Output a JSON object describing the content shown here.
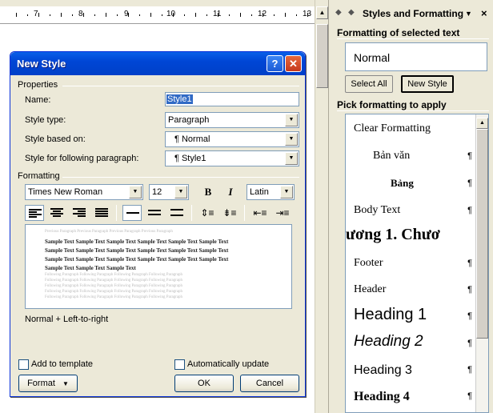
{
  "ruler": {
    "numbers": [
      "7",
      "8",
      "9",
      "10",
      "11",
      "12",
      "13"
    ]
  },
  "task_pane": {
    "title": "Styles and Formatting",
    "back_icon": "back-arrow-icon",
    "forward_icon": "forward-arrow-icon",
    "section1_title": "Formatting of selected text",
    "current_style": "Normal",
    "select_all_label": "Select All",
    "new_style_label": "New Style",
    "section2_title": "Pick formatting to apply",
    "styles": [
      {
        "label": "Clear Formatting",
        "pilcrow": ""
      },
      {
        "label": "Bản văn",
        "pilcrow": "¶"
      },
      {
        "label": "Bảng",
        "pilcrow": "¶"
      },
      {
        "label": "Body Text",
        "pilcrow": "¶"
      },
      {
        "label": "ương 1.  Chươ",
        "pilcrow": ""
      },
      {
        "label": "Footer",
        "pilcrow": "¶"
      },
      {
        "label": "Header",
        "pilcrow": "¶"
      },
      {
        "label": "Heading 1",
        "pilcrow": "¶"
      },
      {
        "label": "Heading 2",
        "pilcrow": "¶"
      },
      {
        "label": "Heading 3",
        "pilcrow": "¶"
      },
      {
        "label": "Heading 4",
        "pilcrow": "¶"
      },
      {
        "label": "",
        "pilcrow": ""
      }
    ]
  },
  "dialog": {
    "title": "New Style",
    "help_label": "?",
    "close_label": "✕",
    "properties_label": "Properties",
    "name_label": "Name:",
    "name_value": "Style1",
    "style_type_label": "Style type:",
    "style_type_value": "Paragraph",
    "based_on_label": "Style based on:",
    "based_on_value": "¶  Normal",
    "following_label": "Style for following paragraph:",
    "following_value": "¶  Style1",
    "formatting_label": "Formatting",
    "font_value": "Times New Roman",
    "size_value": "12",
    "bold_label": "B",
    "italic_label": "I",
    "script_value": "Latin",
    "preview_gray": "Previous Paragraph Previous Paragraph Previous Paragraph Previous Paragraph",
    "preview_sample": "Sample Text Sample Text Sample Text Sample Text Sample Text Sample Text",
    "preview_sample_short": "Sample Text Sample Text Sample Text",
    "preview_follow": "Following Paragraph Following Paragraph Following Paragraph Following Paragraph",
    "description": "Normal + Left-to-right",
    "add_template_label": "Add to template",
    "auto_update_label": "Automatically update",
    "format_label": "Format",
    "ok_label": "OK",
    "cancel_label": "Cancel"
  }
}
